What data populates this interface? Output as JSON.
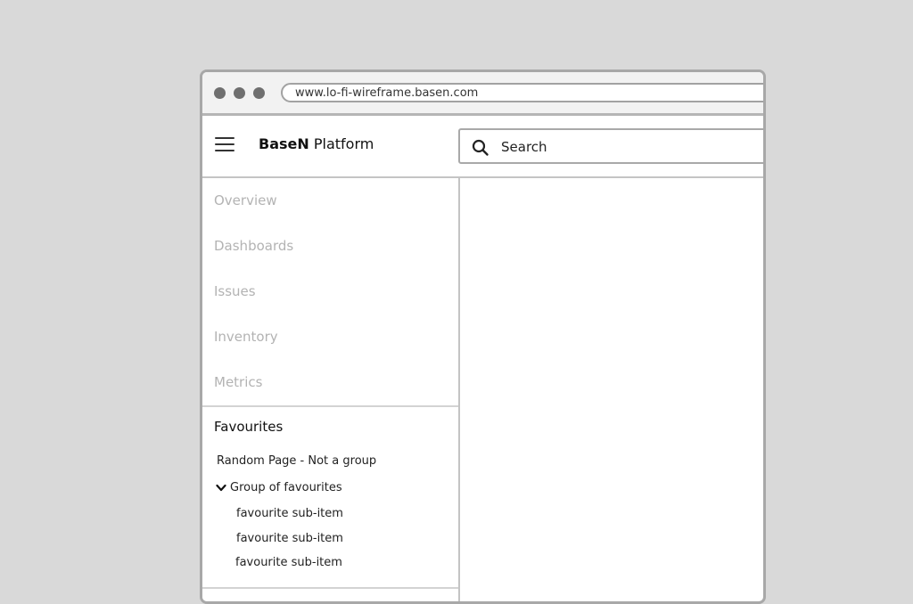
{
  "browser": {
    "url": "www.lo-fi-wireframe.basen.com",
    "dot_color": "#6f6f6f"
  },
  "header": {
    "brand_bold": "BaseN",
    "brand_rest": " Platform",
    "search_placeholder": "Search"
  },
  "sidebar": {
    "nav_items": [
      {
        "label": "Overview"
      },
      {
        "label": "Dashboards"
      },
      {
        "label": "Issues"
      },
      {
        "label": "Inventory"
      },
      {
        "label": "Metrics"
      }
    ],
    "favourites": {
      "title": "Favourites",
      "single_item": "Random Page - Not a group",
      "group": {
        "label": "Group of favourites",
        "expanded": true,
        "children": [
          {
            "label": "favourite sub-item"
          },
          {
            "label": "favourite sub-item"
          },
          {
            "label": "favourite sub-item"
          }
        ]
      }
    }
  }
}
